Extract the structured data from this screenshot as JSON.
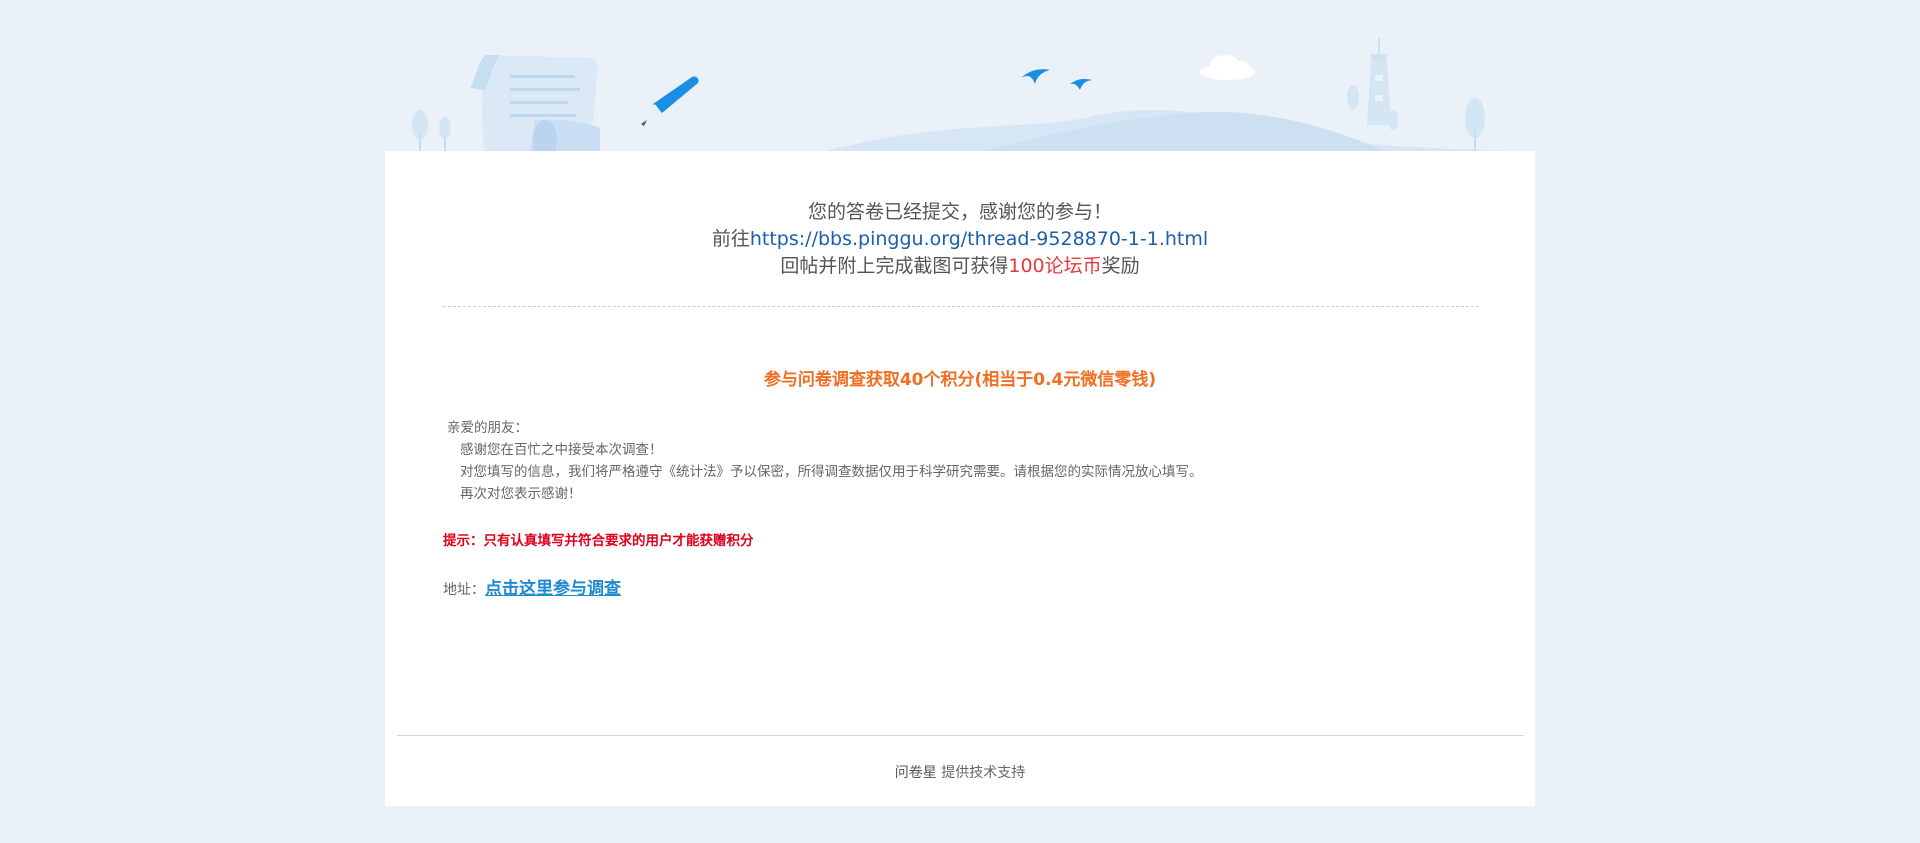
{
  "confirmation": {
    "line1": "您的答卷已经提交，感谢您的参与！",
    "line2_prefix": "前往",
    "line2_link": "https://bbs.pinggu.org/thread-9528870-1-1.html",
    "line3_prefix": "回帖并附上完成截图可获得",
    "line3_reward": "100论坛币",
    "line3_suffix": "奖励"
  },
  "survey": {
    "title": "参与问卷调查获取40个积分(相当于0.4元微信零钱)",
    "greeting": "亲爱的朋友：",
    "paragraphs": [
      "感谢您在百忙之中接受本次调查！",
      "对您填写的信息，我们将严格遵守《统计法》予以保密，所得调查数据仅用于科学研究需要。请根据您的实际情况放心填写。",
      "再次对您表示感谢！"
    ],
    "tip": "提示：只有认真填写并符合要求的用户才能获赠积分",
    "address_label": "地址：",
    "address_link": "点击这里参与调查"
  },
  "footer": {
    "brand": "问卷星",
    "text": "提供技术支持"
  },
  "colors": {
    "background": "#eaf1f8",
    "link_blue": "#1d5fa8",
    "reward_red": "#e8383d",
    "title_orange": "#f07023",
    "tip_red": "#e0001b",
    "survey_link": "#1e8ad0"
  },
  "icons": {
    "banner": [
      "scroll-paper-icon",
      "pen-icon",
      "bird-icon",
      "cloud-icon",
      "lighthouse-icon",
      "tree-icon"
    ]
  }
}
